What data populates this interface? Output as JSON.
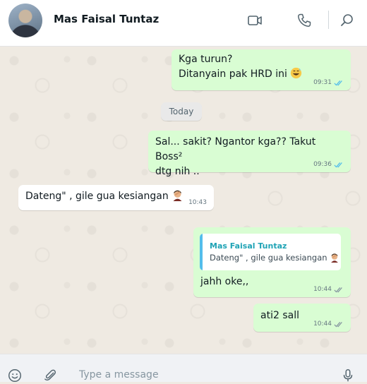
{
  "header": {
    "contact_name": "Mas Faisal Tuntaz",
    "icons": [
      "video-call-icon",
      "voice-call-icon",
      "search-icon"
    ]
  },
  "messages": [
    {
      "direction": "outgoing",
      "lines": [
        "Kga turun?",
        "Ditanyain pak HRD ini"
      ],
      "emoji": "grinning-sweat-emoji",
      "time": "09:31",
      "status": "read"
    },
    {
      "type": "day-separator",
      "label": "Today"
    },
    {
      "direction": "outgoing",
      "lines": [
        "Sal... sakit? Ngantor kga?? Takut Boss²",
        "dtg nih .."
      ],
      "time": "09:36",
      "status": "read"
    },
    {
      "direction": "incoming",
      "lines": [
        "Dateng\" , gile gua kesiangan"
      ],
      "emoji": "person-facepalming-emoji",
      "time": "10:43"
    },
    {
      "direction": "outgoing",
      "quote": {
        "author": "Mas Faisal Tuntaz",
        "text": "Dateng\" , gile gua kesiangan"
      },
      "lines": [
        "jahh oke,,"
      ],
      "time": "10:44",
      "status": "delivered"
    },
    {
      "direction": "outgoing",
      "lines": [
        "ati2 sall"
      ],
      "time": "10:44",
      "status": "delivered"
    }
  ],
  "composer": {
    "placeholder": "Type a message",
    "icons": [
      "emoji-icon",
      "attach-icon",
      "microphone-icon"
    ]
  },
  "colors": {
    "outgoing_bubble": "#d9fdd3",
    "incoming_bubble": "#ffffff",
    "read_tick": "#53bdeb",
    "quote_accent": "#53bdeb",
    "chat_background": "#efeae2"
  }
}
